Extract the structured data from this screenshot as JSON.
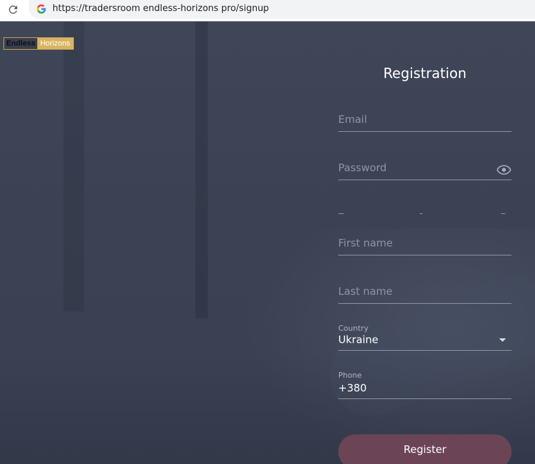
{
  "browser": {
    "url": "https://tradersroom endless-horizons pro/signup"
  },
  "logo": {
    "left_text": "Endless",
    "right_text": "Horizons"
  },
  "form": {
    "title": "Registration",
    "email_placeholder": "Email",
    "password_placeholder": "Password",
    "first_name_placeholder": "First name",
    "last_name_placeholder": "Last name",
    "country_label": "Country",
    "country_value": "Ukraine",
    "phone_label": "Phone",
    "phone_value": "+380",
    "register_label": "Register"
  },
  "colors": {
    "background": "#3b4252",
    "button": "#6b4556",
    "logo_gold": "#d8b462"
  },
  "icons": [
    "reload-icon",
    "google-icon",
    "eye-icon",
    "caret-down-icon"
  ]
}
